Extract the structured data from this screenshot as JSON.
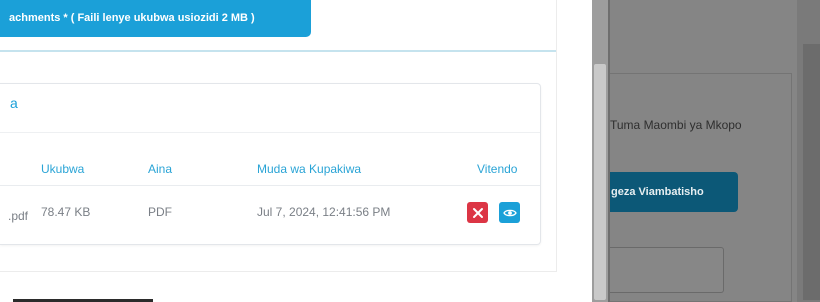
{
  "attachments": {
    "button_label": "achments * ( Faili lenye ukubwa usiozidi 2 MB )"
  },
  "files_card": {
    "title": "a",
    "columns": [
      "Ukubwa",
      "Aina",
      "Muda wa Kupakiwa",
      "Vitendo"
    ],
    "rows": [
      {
        "name": ".pdf",
        "size": "78.47 KB",
        "type": "PDF",
        "uploaded": "Jul 7, 2024, 12:41:56 PM"
      }
    ],
    "colors": {
      "delete": "#dc3545",
      "view": "#1ba0d8"
    },
    "icons": {
      "delete": "close-icon",
      "view": "eye-icon"
    }
  },
  "modal": {
    "text": "Tuma Maombi ya Mkopo",
    "button_label": "geza Viambatisho"
  },
  "colors": {
    "accent": "#1ba0d8",
    "overlay": "#818181",
    "modal_button": "#0c5877"
  }
}
